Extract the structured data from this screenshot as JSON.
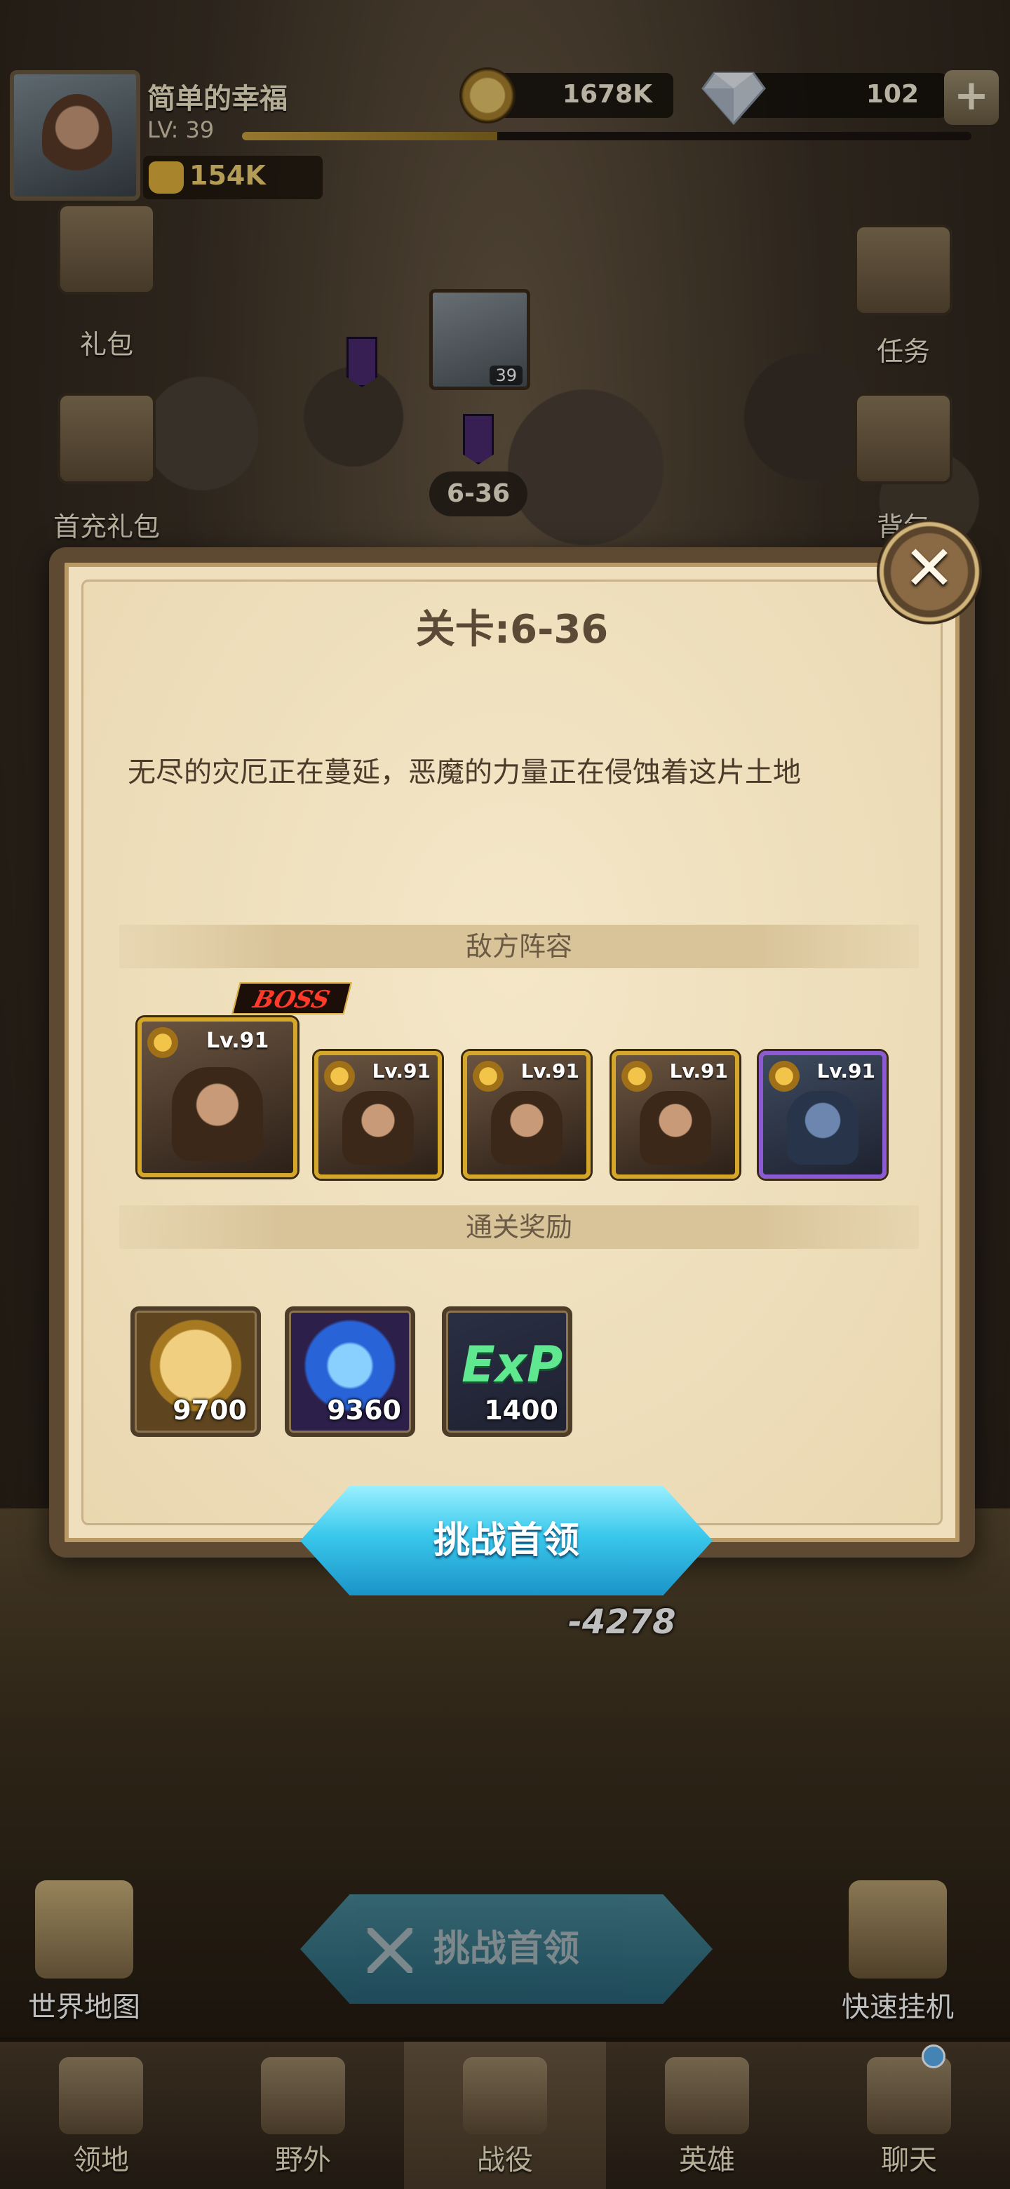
{
  "player": {
    "name": "简单的幸福",
    "level_label": "LV: 39",
    "xp_progress": 0.35,
    "power": "154K"
  },
  "currency": {
    "gold": "1678K",
    "diamonds": "102",
    "add_icon": "plus-icon"
  },
  "side_menu": {
    "left": [
      {
        "label": "礼包",
        "icon": "gift-box-icon"
      },
      {
        "label": "首充礼包",
        "icon": "first-recharge-hero-icon"
      }
    ],
    "right": [
      {
        "label": "任务",
        "icon": "scroll-quest-icon"
      },
      {
        "label": "背包",
        "icon": "backpack-icon"
      }
    ]
  },
  "map": {
    "avatar_level": "39",
    "stage": "6-36"
  },
  "dialog": {
    "title": "关卡:6-36",
    "description": "无尽的灾厄正在蔓延，恶魔的力量正在侵蚀着这片土地",
    "enemy_section": "敌方阵容",
    "boss_tag": "BOSS",
    "enemies": [
      {
        "level": "Lv.91",
        "boss": true,
        "frame": "gold"
      },
      {
        "level": "Lv.91",
        "boss": false,
        "frame": "gold"
      },
      {
        "level": "Lv.91",
        "boss": false,
        "frame": "gold"
      },
      {
        "level": "Lv.91",
        "boss": false,
        "frame": "gold"
      },
      {
        "level": "Lv.91",
        "boss": false,
        "frame": "purple"
      }
    ],
    "reward_section": "通关奖励",
    "rewards": [
      {
        "type": "gold",
        "amount": "9700"
      },
      {
        "type": "hero-dust",
        "amount": "9360"
      },
      {
        "type": "exp",
        "label": "ExP",
        "amount": "1400"
      }
    ],
    "challenge_button": "挑战首领",
    "close_icon": "close-icon"
  },
  "battle": {
    "damage_number": "-4278"
  },
  "bottom_actions": {
    "world_map": "世界地图",
    "quick_idle": "快速挂机",
    "challenge_button": "挑战首领"
  },
  "tabs": [
    {
      "label": "领地",
      "icon": "castle-icon",
      "active": false
    },
    {
      "label": "野外",
      "icon": "wilderness-scroll-icon",
      "active": false
    },
    {
      "label": "战役",
      "icon": "campaign-sword-icon",
      "active": true
    },
    {
      "label": "英雄",
      "icon": "helmet-icon",
      "active": false
    },
    {
      "label": "聊天",
      "icon": "chat-icon",
      "active": false
    }
  ],
  "colors": {
    "accent_cyan": "#3ac8ec",
    "gold_frame": "#d4a62a",
    "purple_frame": "#8c5ad4",
    "parchment": "#efdfbc"
  }
}
